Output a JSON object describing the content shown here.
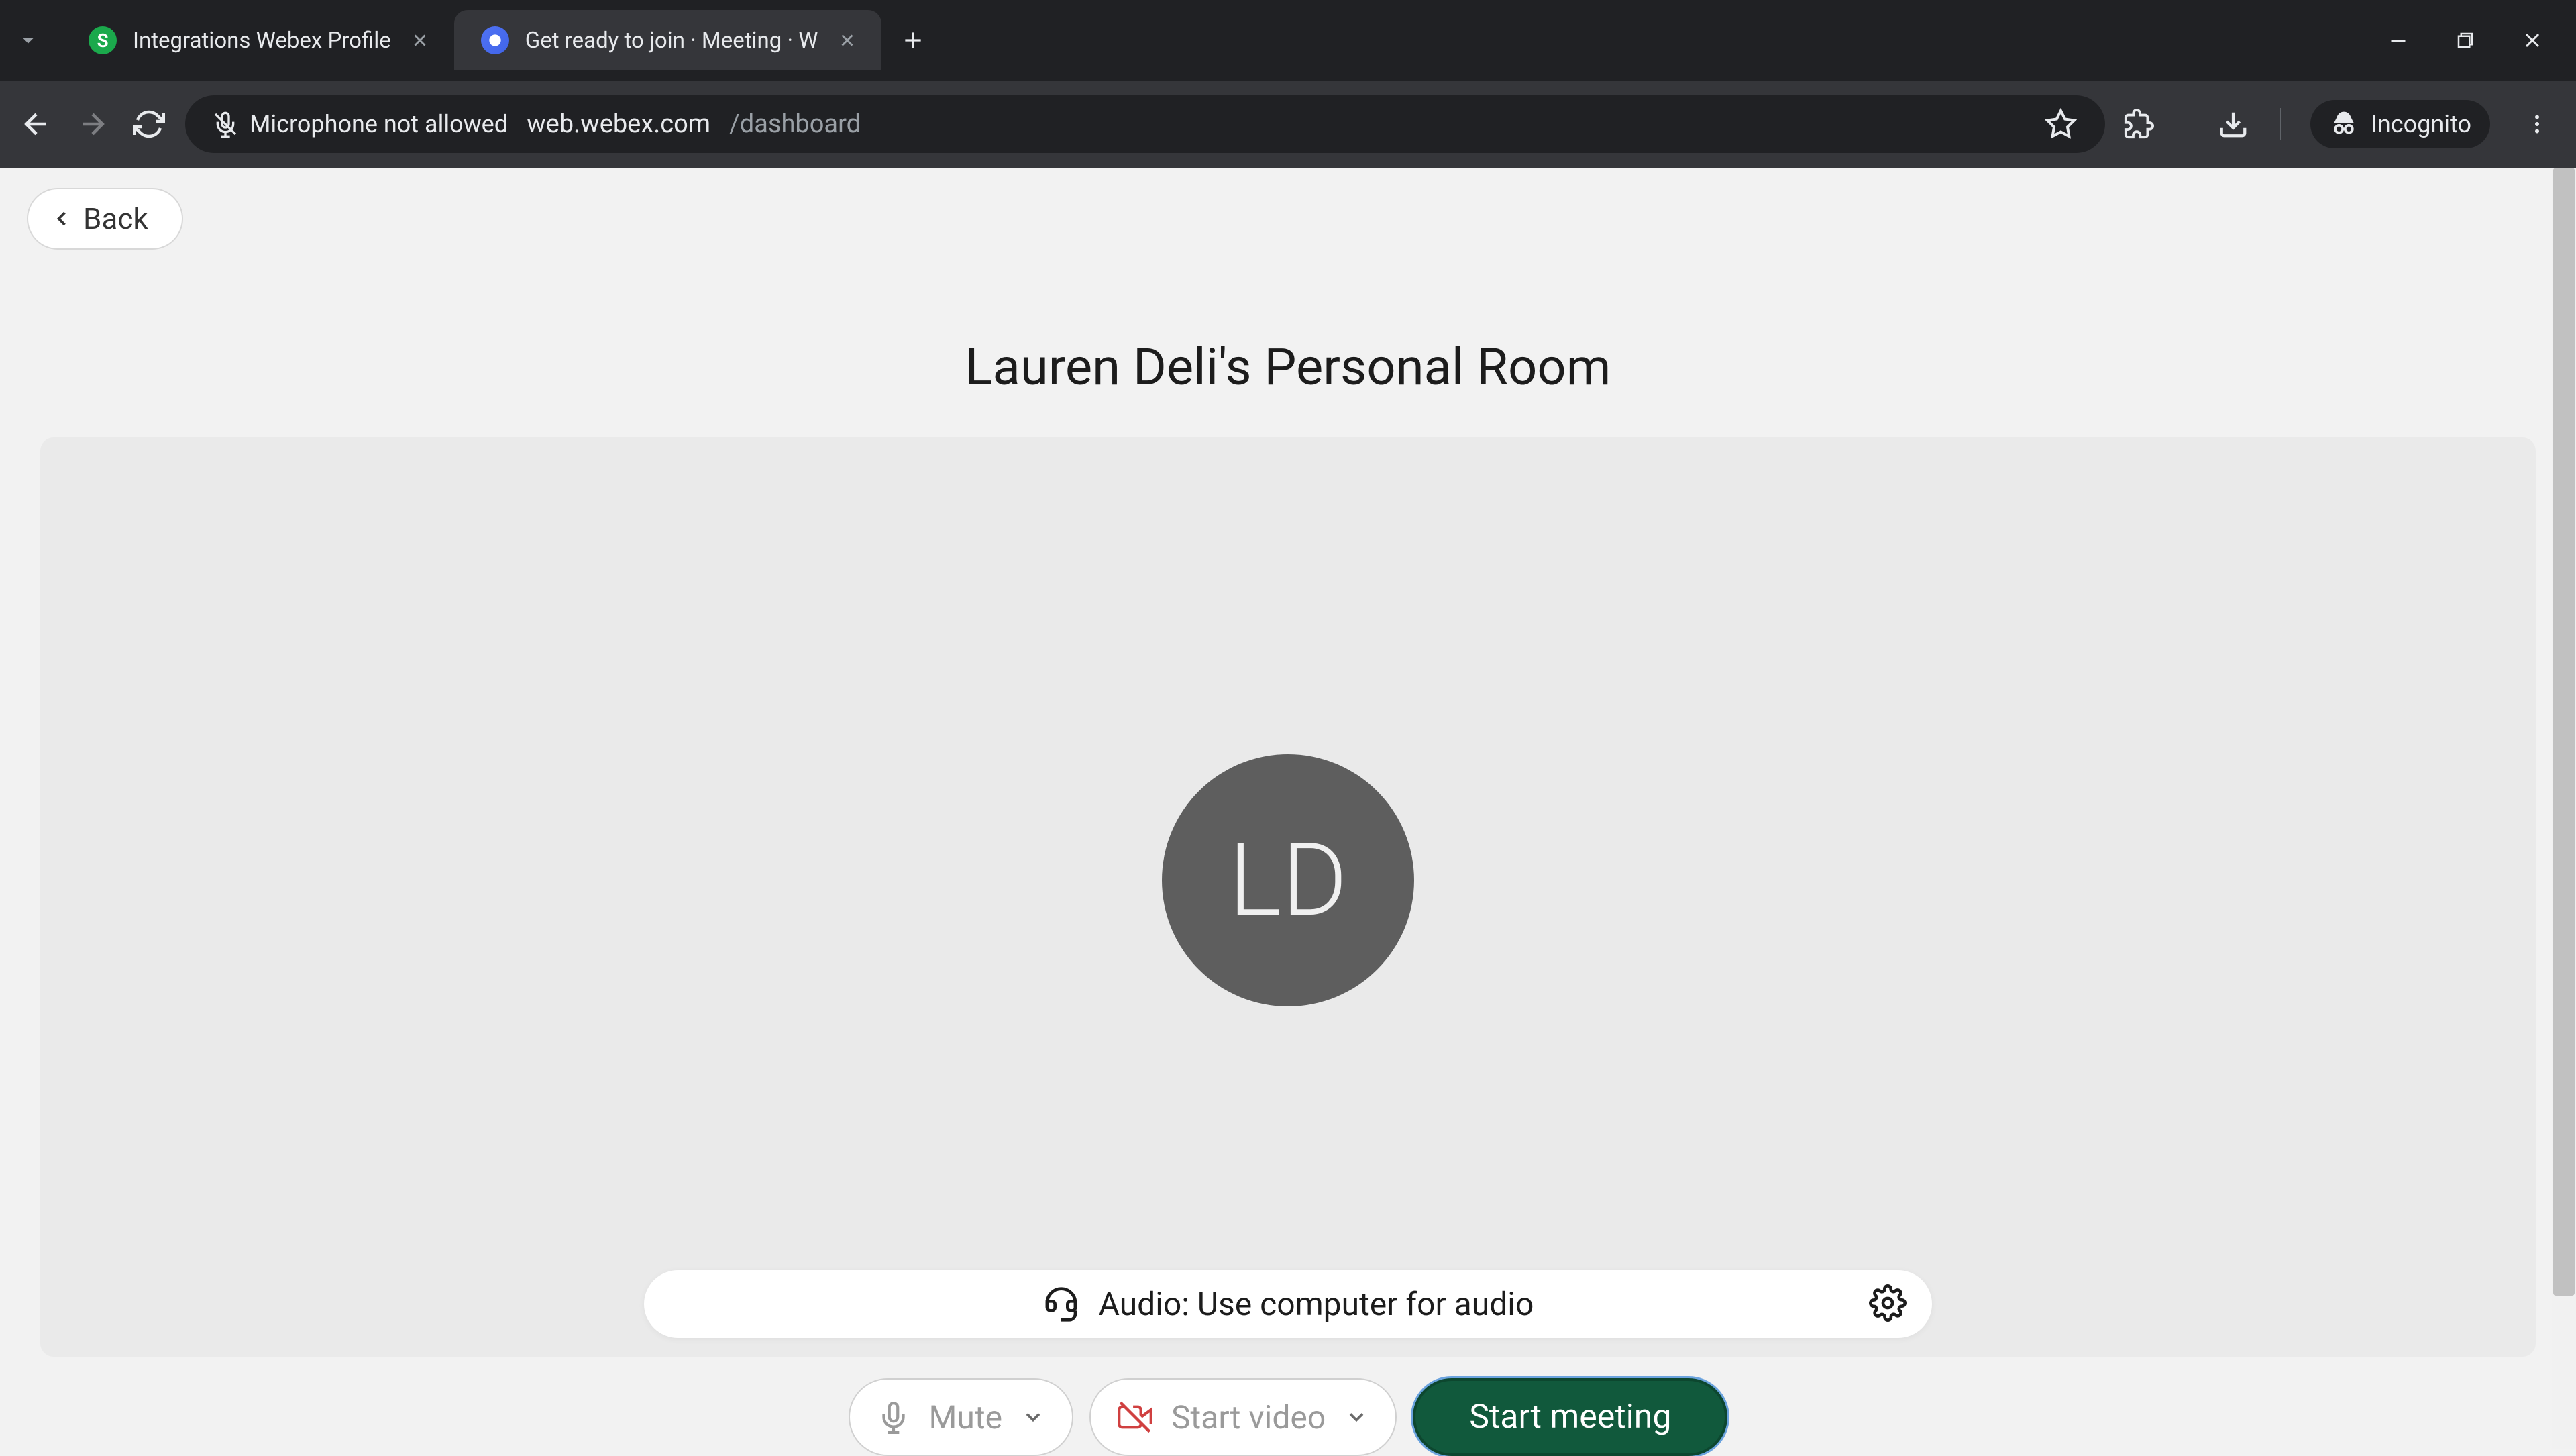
{
  "browser": {
    "tabs": [
      {
        "title": "Integrations Webex Profile",
        "favicon_letter": "S"
      },
      {
        "title": "Get ready to join · Meeting · W"
      }
    ],
    "url_host": "web.webex.com",
    "url_path": "/dashboard",
    "mic_status": "Microphone not allowed",
    "incognito_label": "Incognito"
  },
  "page": {
    "back_label": "Back",
    "room_title": "Lauren Deli's Personal Room",
    "avatar_initials": "LD",
    "audio_label": "Audio: Use computer for audio",
    "mute_label": "Mute",
    "video_label": "Start video",
    "start_label": "Start meeting"
  }
}
